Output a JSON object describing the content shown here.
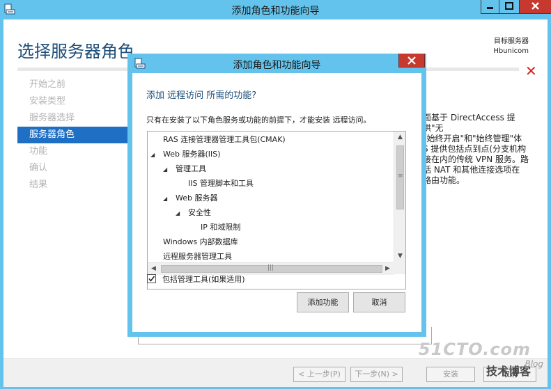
{
  "window": {
    "title": "添加角色和功能向导",
    "icon": "server-manager-icon",
    "controls": [
      "minimize-icon",
      "maximize-icon",
      "close-icon"
    ]
  },
  "page": {
    "title": "选择服务器角色",
    "dest_label": "目标服务器",
    "dest_name": "Hbunicom"
  },
  "nav": {
    "items": [
      {
        "label": "开始之前",
        "active": false
      },
      {
        "label": "安装类型",
        "active": false
      },
      {
        "label": "服务器选择",
        "active": false
      },
      {
        "label": "服务器角色",
        "active": true
      },
      {
        "label": "功能",
        "active": false
      },
      {
        "label": "确认",
        "active": false
      },
      {
        "label": "结果",
        "active": false
      }
    ]
  },
  "description": {
    "lines": [
      "面基于 DirectAccess 提供\"无",
      "\"始终开启\"和\"始终管理\"体",
      "S 提供包括点到点(分支机构",
      "接在内的传统 VPN 服务。路",
      "括 NAT 和其他连接选项在",
      "路由功能。"
    ]
  },
  "footer": {
    "prev": "< 上一步(P)",
    "next": "下一步(N) >",
    "install": "安装",
    "cancel": "取消"
  },
  "watermark": {
    "brand": "51CTO.com",
    "slogan": "技术博客",
    "blog": "Blog"
  },
  "dialog": {
    "title": "添加角色和功能向导",
    "heading": "添加 远程访问 所需的功能?",
    "subtitle": "只有在安装了以下角色服务或功能的前提下，才能安装 远程访问。",
    "tree": [
      {
        "label": "RAS 连接管理器管理工具包(CMAK)",
        "level": 0,
        "expanded": null
      },
      {
        "label": "Web 服务器(IIS)",
        "level": 0,
        "expanded": true
      },
      {
        "label": "管理工具",
        "level": 1,
        "expanded": true
      },
      {
        "label": "IIS 管理脚本和工具",
        "level": 2,
        "expanded": null
      },
      {
        "label": "Web 服务器",
        "level": 1,
        "expanded": true
      },
      {
        "label": "安全性",
        "level": 2,
        "expanded": true
      },
      {
        "label": "IP 和域限制",
        "level": 3,
        "expanded": null
      },
      {
        "label": "Windows 内部数据库",
        "level": 0,
        "expanded": null
      },
      {
        "label": "远程服务器管理工具",
        "level": 0,
        "expanded": null
      }
    ],
    "include_tools_label": "包括管理工具(如果适用)",
    "include_tools_checked": true,
    "add_button": "添加功能",
    "cancel_button": "取消"
  }
}
